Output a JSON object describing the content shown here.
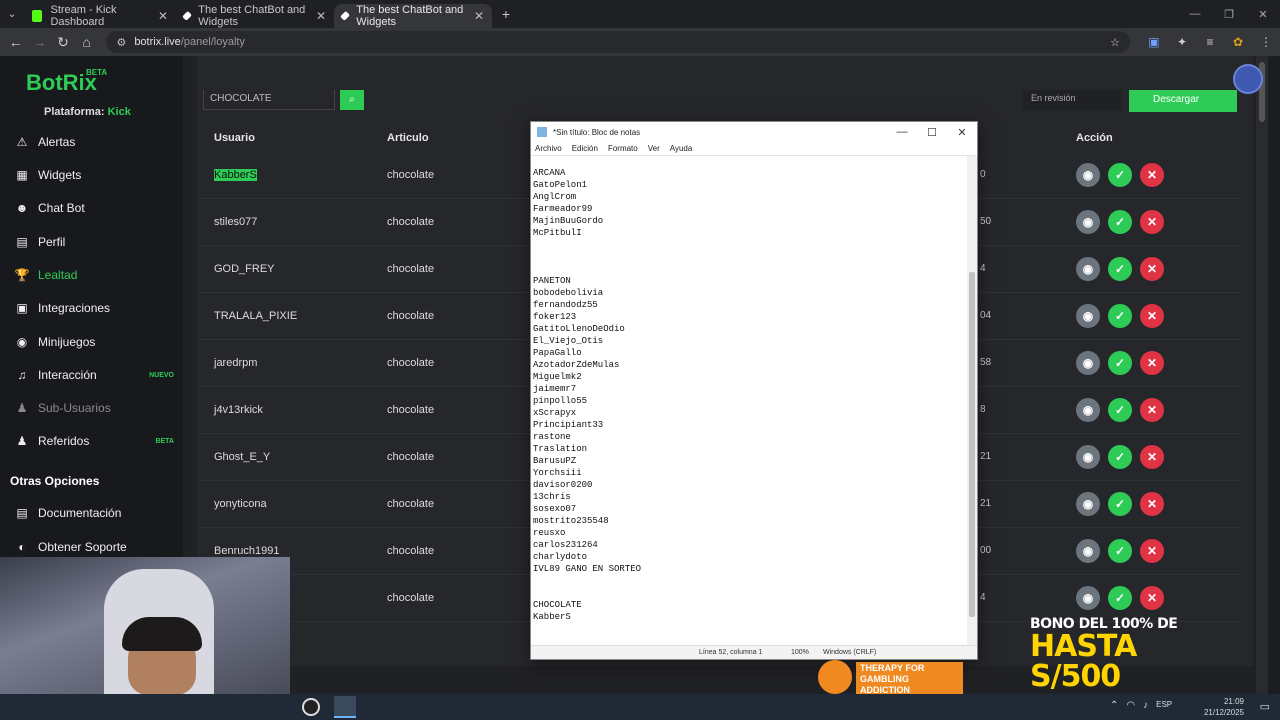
{
  "browser": {
    "tabs": [
      {
        "label": "Stream - Kick Dashboard",
        "active": false,
        "fav_color": "#53fc18"
      },
      {
        "label": "The best ChatBot and Widgets",
        "active": false,
        "fav_color": "#ffffff"
      },
      {
        "label": "The best ChatBot and Widgets",
        "active": true,
        "fav_color": "#ffffff"
      }
    ],
    "url_host": "botrix.live",
    "url_path": "/panel/loyalty"
  },
  "sidebar": {
    "brand": "BotRix",
    "beta": "BETA",
    "platform_label": "Plataforma:",
    "platform_value": "Kick",
    "items": [
      {
        "label": "Alertas",
        "icon": "⚠"
      },
      {
        "label": "Widgets",
        "icon": "▦"
      },
      {
        "label": "Chat Bot",
        "icon": "☻"
      },
      {
        "label": "Perfil",
        "icon": "▤"
      },
      {
        "label": "Lealtad",
        "icon": "🏆"
      },
      {
        "label": "Integraciones",
        "icon": "▣"
      },
      {
        "label": "Minijuegos",
        "icon": "◉"
      },
      {
        "label": "Interacción",
        "icon": "♫",
        "badge": "NUEVO"
      },
      {
        "label": "Sub-Usuarios",
        "icon": "♟"
      },
      {
        "label": "Referidos",
        "icon": "♟",
        "badge": "BETA"
      }
    ],
    "other_title": "Otras Opciones",
    "other_items": [
      {
        "label": "Documentación",
        "icon": "▤"
      },
      {
        "label": "Obtener Soporte",
        "icon": "◐"
      }
    ]
  },
  "table": {
    "search_value": "CHOCOLATE",
    "filter_value": "En revisión",
    "download_label": "Descargar",
    "headers": {
      "user": "Usuario",
      "article": "Articulo",
      "action": "Acción"
    },
    "rows": [
      {
        "user": "KabberS",
        "article": "chocolate",
        "num": "0"
      },
      {
        "user": "stiles077",
        "article": "chocolate",
        "num": "50"
      },
      {
        "user": "GOD_FREY",
        "article": "chocolate",
        "num": "4"
      },
      {
        "user": "TRALALA_PIXIE",
        "article": "chocolate",
        "num": "04"
      },
      {
        "user": "jaredrpm",
        "article": "chocolate",
        "num": "58"
      },
      {
        "user": "j4v13rkick",
        "article": "chocolate",
        "num": "8"
      },
      {
        "user": "Ghost_E_Y",
        "article": "chocolate",
        "num": "21"
      },
      {
        "user": "yonyticona",
        "article": "chocolate",
        "num": "21"
      },
      {
        "user": "Benruch1991",
        "article": "chocolate",
        "num": "00"
      },
      {
        "user": "",
        "article": "chocolate",
        "num": "4"
      }
    ]
  },
  "notepad": {
    "title": "*Sin título: Bloc de notas",
    "menu": [
      "Archivo",
      "Edición",
      "Formato",
      "Ver",
      "Ayuda"
    ],
    "content": "ARCANA\nGatoPelon1\nAnglCrom\nFarmeador99\nMajinBuuGordo\nMcPitbulI\n\n\n\nPANETON\nbobodebolivia\nfernandodz55\nfoker123\nGatitoLlenoDeOdio\nEl_Viejo_Otis\nPapaGallo\nAzotadorZdeMulas\nMiguelmk2\njaimemr7\npinpollo55\nxScrapyx\nPrincipiant33\nrastone\nTraslation\nBarusuPZ\nYorchsiii\ndavisor0200\n13chris\nsosexo07\nmostrito235548\nreusxo\ncarlos231264\ncharlydoto\nIVL89 GANO EN SORTEO\n\n\nCHOCOLATE\nKabberS",
    "status_pos": "Línea 52, columna 1",
    "status_zoom": "100%",
    "status_eol": "Windows (CRLF)"
  },
  "overlay": {
    "promo_line1": "BONO DEL 100% DE",
    "promo_line2": "HASTA S/500",
    "gamble_line1": "THERAPY FOR",
    "gamble_line2": "GAMBLING ADDICTION"
  },
  "taskbar": {
    "lang": "ESP",
    "time": "21:09",
    "date": "21/12/2025"
  }
}
